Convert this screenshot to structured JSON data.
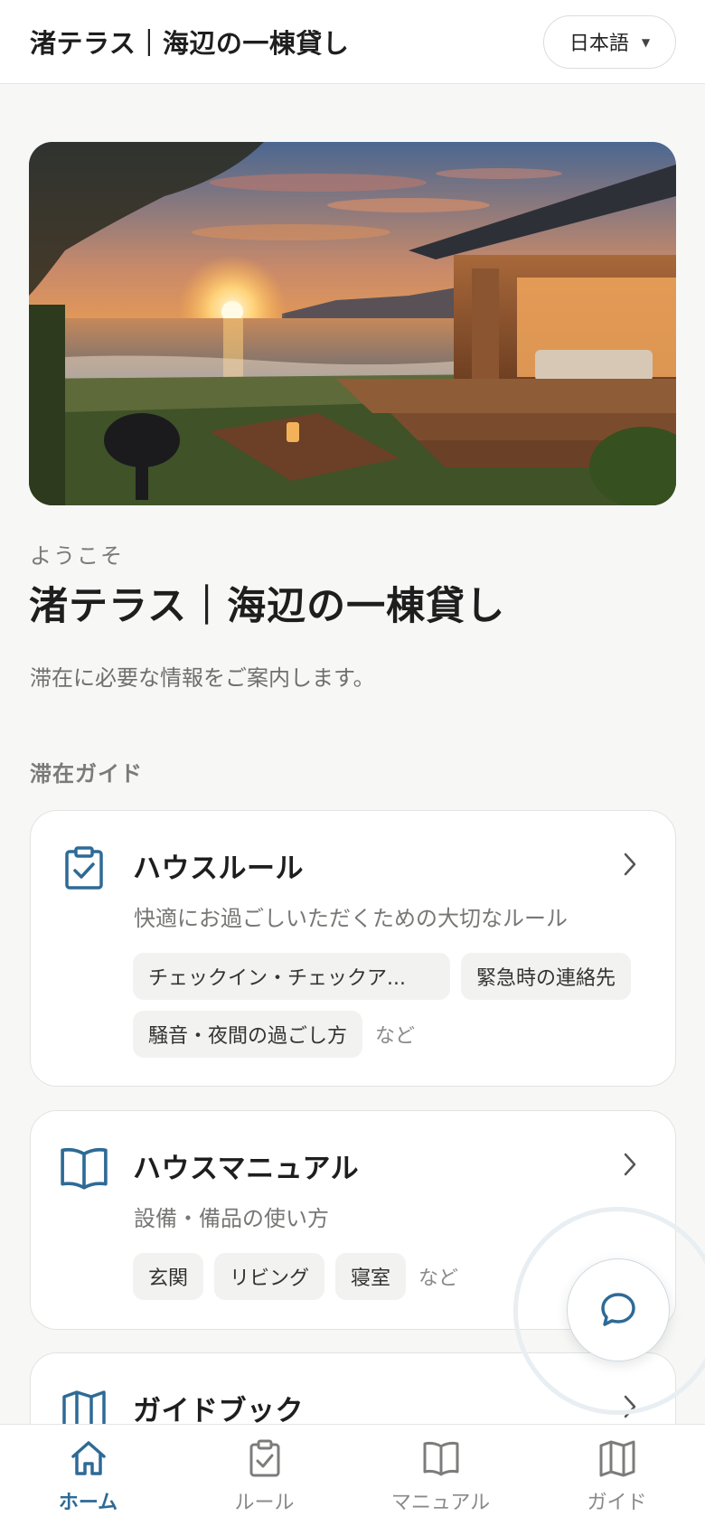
{
  "header": {
    "title": "渚テラス｜海辺の一棟貸し",
    "language": "日本語"
  },
  "hero": {
    "image_icon": "beach-house-sunset-photo"
  },
  "welcome": {
    "label": "ようこそ",
    "title": "渚テラス｜海辺の一棟貸し",
    "description": "滞在に必要な情報をご案内します。"
  },
  "section": {
    "label": "滞在ガイド"
  },
  "cards": [
    {
      "icon": "clipboard-check-icon",
      "title": "ハウスルール",
      "subtitle": "快適にお過ごしいただくための大切なルール",
      "tags": [
        "チェックイン・チェックア...",
        "緊急時の連絡先",
        "騒音・夜間の過ごし方"
      ],
      "etc": "など"
    },
    {
      "icon": "open-book-icon",
      "title": "ハウスマニュアル",
      "subtitle": "設備・備品の使い方",
      "tags": [
        "玄関",
        "リビング",
        "寝室"
      ],
      "etc": "など"
    },
    {
      "icon": "folded-map-icon",
      "title": "ガイドブック"
    }
  ],
  "chat": {
    "icon": "chat-bubble-icon"
  },
  "nav": [
    {
      "label": "ホーム",
      "icon": "home-icon",
      "active": true
    },
    {
      "label": "ルール",
      "icon": "clipboard-check-icon",
      "active": false
    },
    {
      "label": "マニュアル",
      "icon": "open-book-icon",
      "active": false
    },
    {
      "label": "ガイド",
      "icon": "folded-map-icon",
      "active": false
    }
  ],
  "colors": {
    "accent": "#2e6a96",
    "background": "#f7f7f6",
    "card": "#ffffff"
  }
}
